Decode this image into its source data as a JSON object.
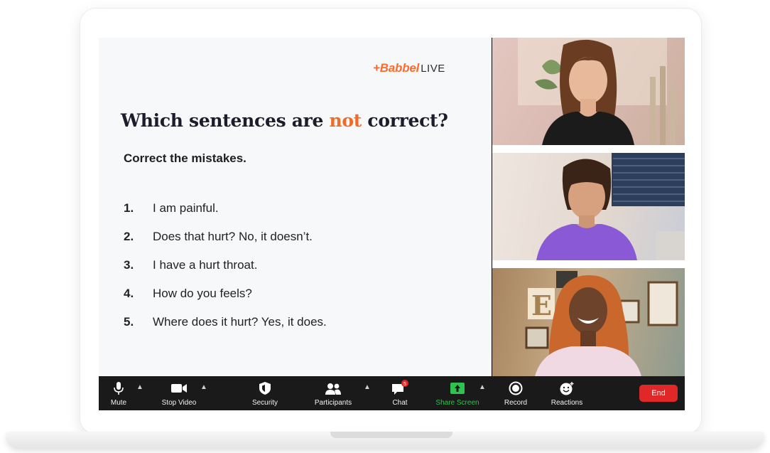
{
  "slide": {
    "brand_prefix": "+Babbel",
    "brand_suffix": "LIVE",
    "question_before": "Which sentences are ",
    "question_highlight": "not",
    "question_after": " correct?",
    "instruction": "Correct the mistakes.",
    "items": [
      {
        "num": "1.",
        "text": "I am painful."
      },
      {
        "num": "2.",
        "text": "Does that hurt? No, it doesn’t."
      },
      {
        "num": "3.",
        "text": "I have a hurt throat."
      },
      {
        "num": "4.",
        "text": "How do you feels?"
      },
      {
        "num": "5.",
        "text": "Where does it hurt? Yes, it does."
      }
    ]
  },
  "toolbar": {
    "mute": "Mute",
    "stop_video": "Stop Video",
    "security": "Security",
    "participants": "Participants",
    "chat": "Chat",
    "share_screen": "Share Screen",
    "record": "Record",
    "reactions": "Reactions",
    "end": "End"
  },
  "colors": {
    "brand_orange": "#ff6b2c",
    "highlight": "#f06a28",
    "toolbar_bg": "#1a1a1a",
    "share_green": "#30c24f",
    "end_red": "#e02828"
  }
}
